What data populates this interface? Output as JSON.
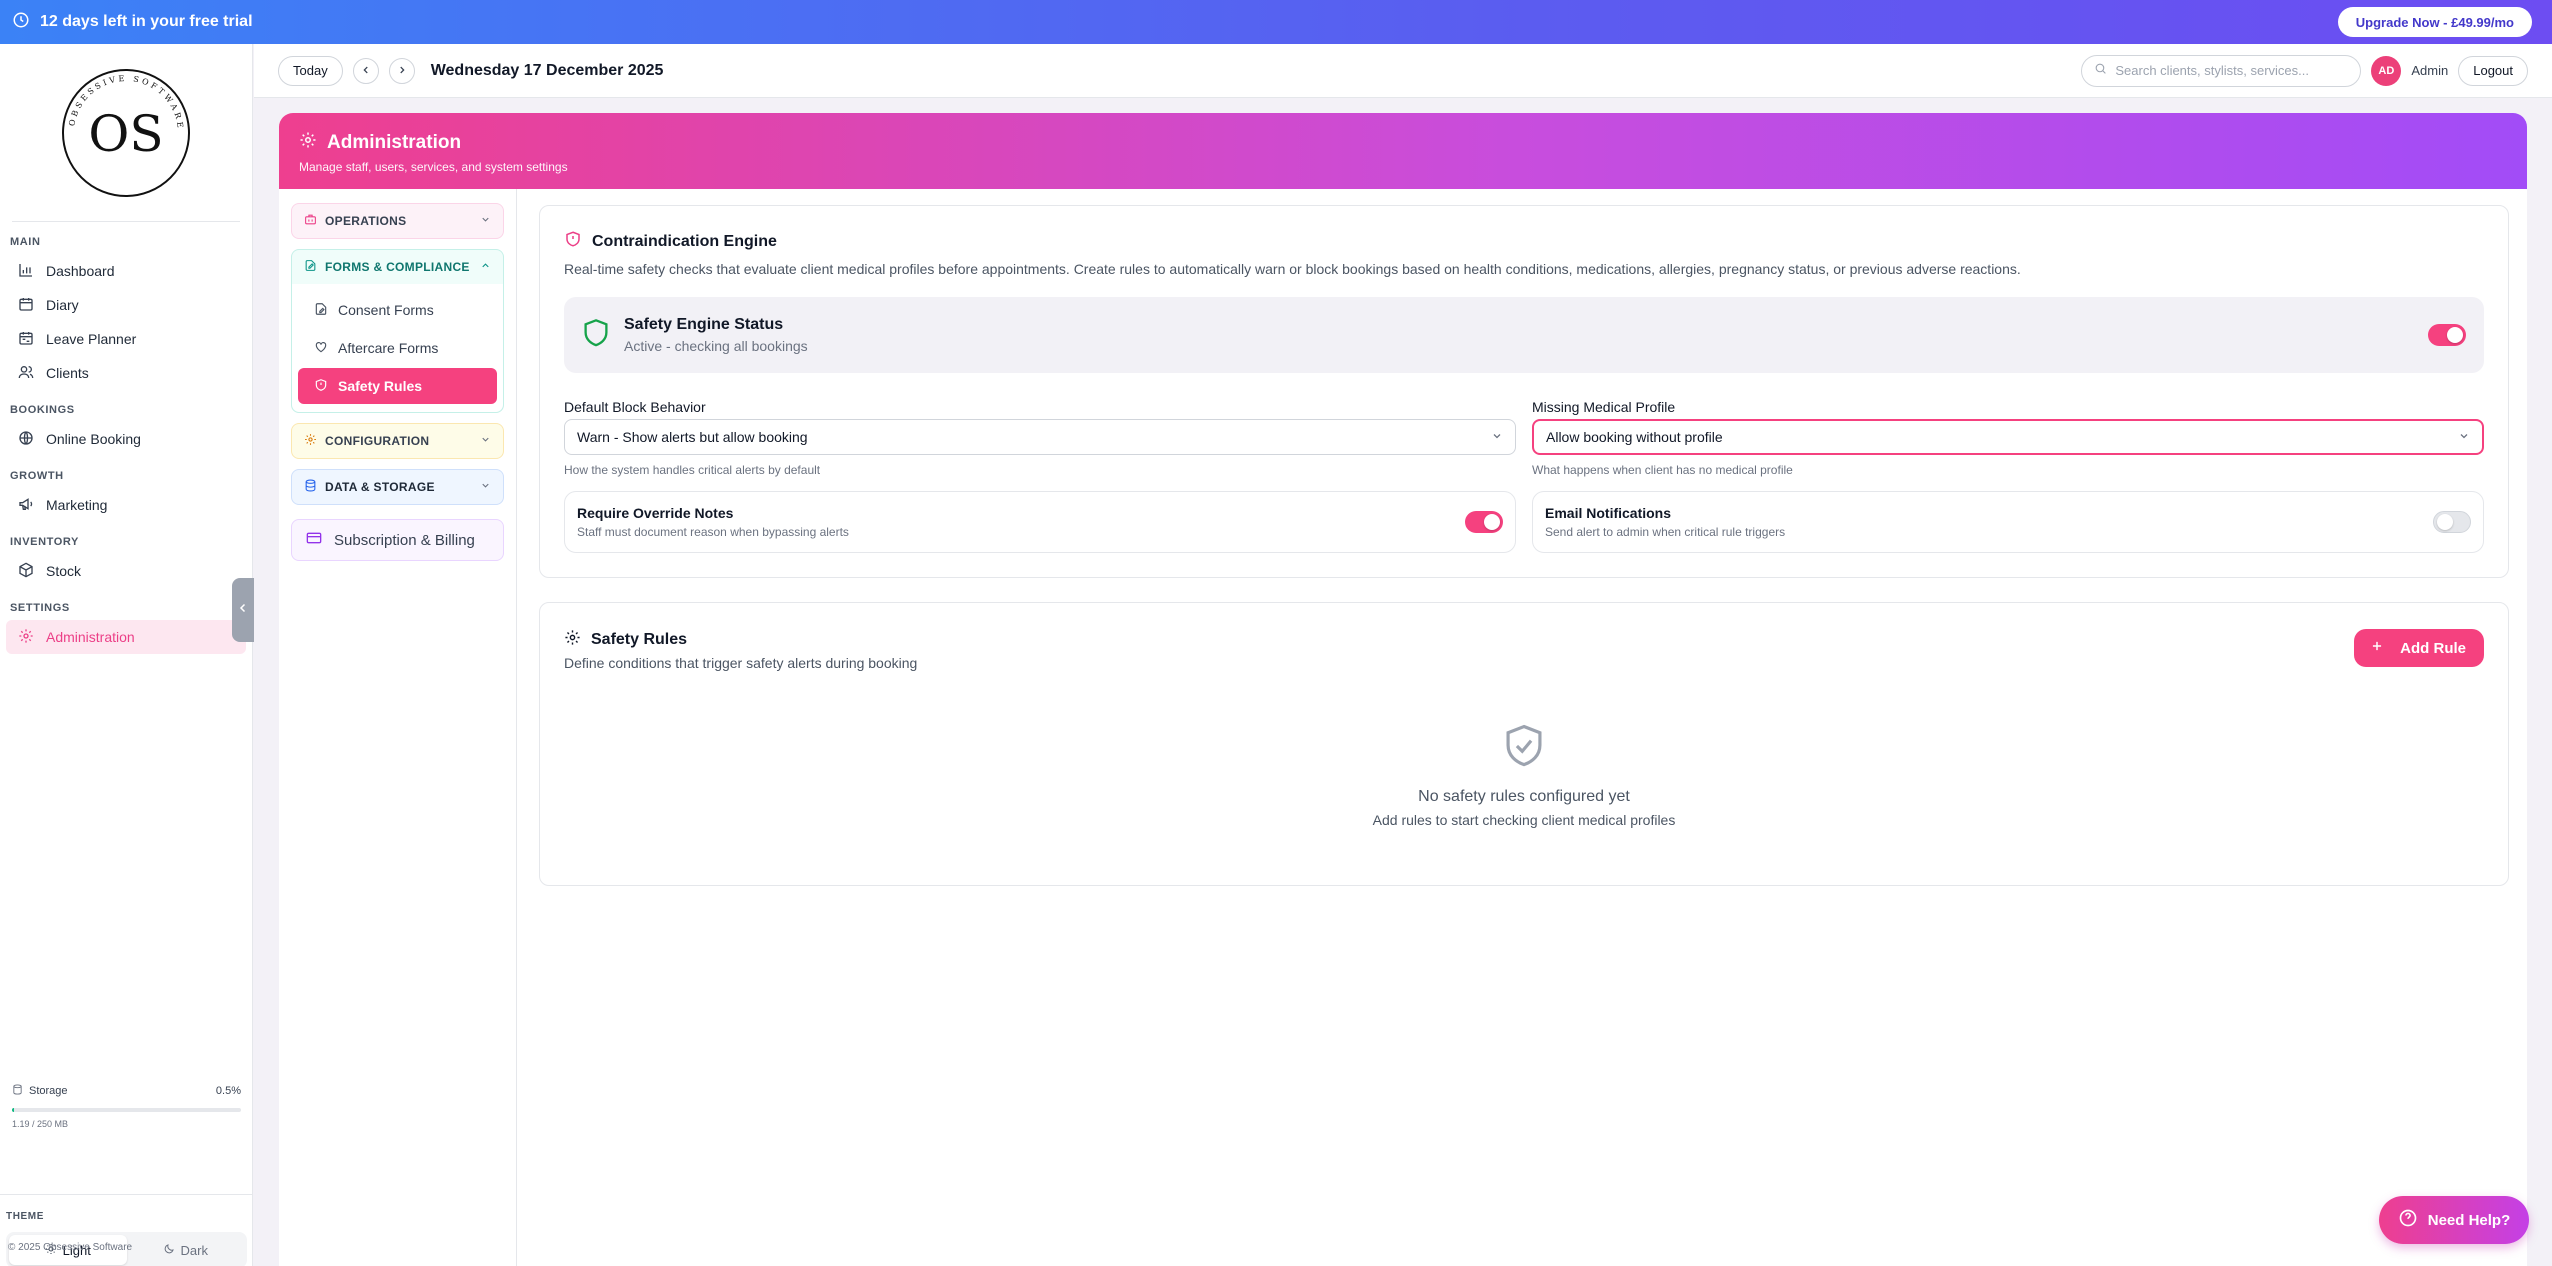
{
  "trial": {
    "text": "12 days left in your free trial",
    "upgrade_label": "Upgrade Now - £49.99/mo"
  },
  "logo": {
    "initials": "OS",
    "ring_text": "OBSESSIVE SOFTWARE"
  },
  "sidebar": {
    "sections": [
      {
        "label": "MAIN",
        "items": [
          {
            "label": "Dashboard",
            "icon": "bar-chart-icon"
          },
          {
            "label": "Diary",
            "icon": "calendar-icon"
          },
          {
            "label": "Leave Planner",
            "icon": "calendar-range-icon"
          },
          {
            "label": "Clients",
            "icon": "users-icon"
          }
        ]
      },
      {
        "label": "BOOKINGS",
        "items": [
          {
            "label": "Online Booking",
            "icon": "globe-icon"
          }
        ]
      },
      {
        "label": "GROWTH",
        "items": [
          {
            "label": "Marketing",
            "icon": "megaphone-icon"
          }
        ]
      },
      {
        "label": "INVENTORY",
        "items": [
          {
            "label": "Stock",
            "icon": "package-icon"
          }
        ]
      },
      {
        "label": "SETTINGS",
        "items": [
          {
            "label": "Administration",
            "icon": "gear-icon",
            "active": true
          }
        ]
      }
    ],
    "storage": {
      "label": "Storage",
      "percent_text": "0.5%",
      "used_fraction": 0.005,
      "detail": "1.19 / 250 MB"
    },
    "theme": {
      "label": "THEME",
      "light": "Light",
      "dark": "Dark",
      "selected": "Light"
    },
    "copyright": "© 2025 Obsessive Software"
  },
  "header": {
    "today_label": "Today",
    "date": "Wednesday 17 December 2025",
    "search_placeholder": "Search clients, stylists, services...",
    "avatar_initials": "AD",
    "user_name": "Admin",
    "logout_label": "Logout"
  },
  "admin": {
    "title": "Administration",
    "subtitle": "Manage staff, users, services, and system settings"
  },
  "subnav": {
    "operations": "OPERATIONS",
    "forms": "FORMS & COMPLIANCE",
    "forms_items": [
      "Consent Forms",
      "Aftercare Forms",
      "Safety Rules"
    ],
    "configuration": "CONFIGURATION",
    "data_storage": "DATA & STORAGE",
    "billing": "Subscription & Billing"
  },
  "engine": {
    "title": "Contraindication Engine",
    "description": "Real-time safety checks that evaluate client medical profiles before appointments. Create rules to automatically warn or block bookings based on health conditions, medications, allergies, pregnancy status, or previous adverse reactions.",
    "status_title": "Safety Engine Status",
    "status_sub": "Active - checking all bookings",
    "status_on": true,
    "block_label": "Default Block Behavior",
    "block_value": "Warn - Show alerts but allow booking",
    "block_help": "How the system handles critical alerts by default",
    "missing_label": "Missing Medical Profile",
    "missing_value": "Allow booking without profile",
    "missing_help": "What happens when client has no medical profile",
    "override_title": "Require Override Notes",
    "override_sub": "Staff must document reason when bypassing alerts",
    "override_on": true,
    "email_title": "Email Notifications",
    "email_sub": "Send alert to admin when critical rule triggers",
    "email_on": false
  },
  "rules": {
    "title": "Safety Rules",
    "subtitle": "Define conditions that trigger safety alerts during booking",
    "add_label": "Add Rule",
    "empty_title": "No safety rules configured yet",
    "empty_sub": "Add rules to start checking client medical profiles"
  },
  "help": {
    "label": "Need Help?"
  },
  "colors": {
    "accent": "#f5417f",
    "trial_start": "#3b82f6",
    "trial_end": "#6d4df2",
    "success": "#10b981"
  }
}
